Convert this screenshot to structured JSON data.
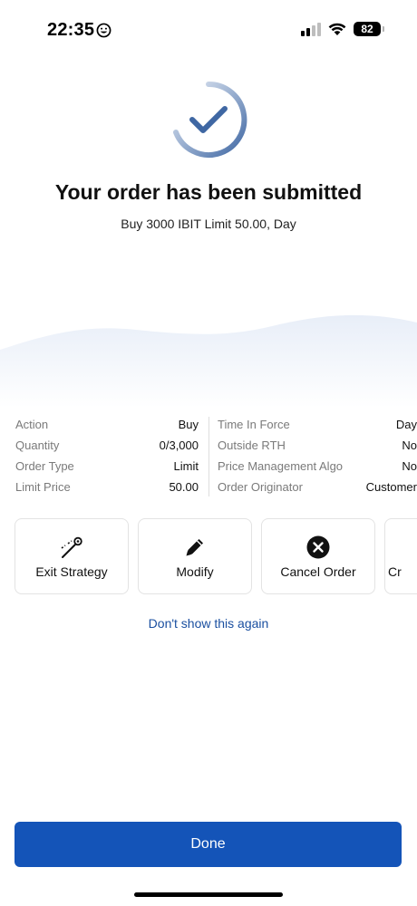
{
  "status_bar": {
    "time": "22:35",
    "battery": "82"
  },
  "hero": {
    "title": "Your order has been submitted",
    "subtitle": "Buy 3000 IBIT Limit 50.00, Day"
  },
  "details": {
    "left": [
      {
        "label": "Action",
        "value": "Buy"
      },
      {
        "label": "Quantity",
        "value": "0/3,000"
      },
      {
        "label": "Order Type",
        "value": "Limit"
      },
      {
        "label": "Limit Price",
        "value": "50.00"
      }
    ],
    "right": [
      {
        "label": "Time In Force",
        "value": "Day"
      },
      {
        "label": "Outside RTH",
        "value": "No"
      },
      {
        "label": "Price Management Algo",
        "value": "No"
      },
      {
        "label": "Order Originator",
        "value": "Customer"
      }
    ]
  },
  "actions": [
    {
      "label": "Exit Strategy",
      "icon": "exit-strategy-icon"
    },
    {
      "label": "Modify",
      "icon": "pencil-icon"
    },
    {
      "label": "Cancel Order",
      "icon": "cancel-circle-icon"
    },
    {
      "label": "Cr",
      "icon": ""
    }
  ],
  "link": "Don't show this again",
  "done_button": "Done",
  "colors": {
    "primary": "#1454b8",
    "link": "#1a4fa0",
    "check_ring": "#3f67a3"
  }
}
